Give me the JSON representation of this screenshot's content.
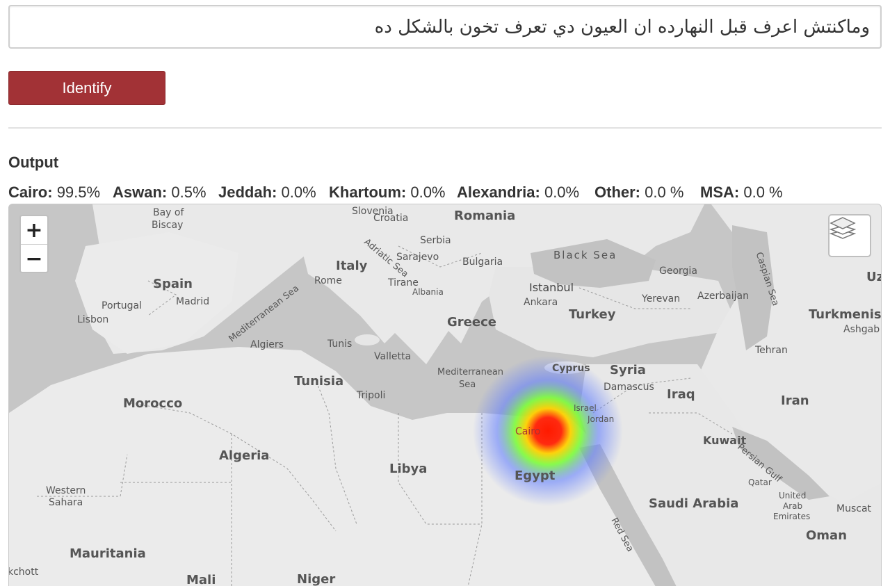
{
  "input": {
    "value": "وماكنتش اعرف قبل النهارده ان العيون دي تعرف تخون بالشكل ده"
  },
  "identify_button": {
    "label": "Identify"
  },
  "output": {
    "heading": "Output",
    "scores": [
      {
        "label": "Cairo:",
        "value": "99.5%"
      },
      {
        "label": "Aswan:",
        "value": "0.5%"
      },
      {
        "label": "Jeddah:",
        "value": "0.0%"
      },
      {
        "label": "Khartoum:",
        "value": "0.0%"
      },
      {
        "label": "Alexandria:",
        "value": "0.0%"
      },
      {
        "label": "Other:",
        "value": "0.0 %"
      },
      {
        "label": "MSA:",
        "value": "0.0 %"
      }
    ]
  },
  "map": {
    "zoom_in": "+",
    "zoom_out": "−",
    "layers_icon": "layers-icon",
    "heat_colors": [
      "#ff0000",
      "#7cfc00",
      "#5a78ff"
    ],
    "labels": {
      "bay_of": "Bay of",
      "biscay": "Biscay",
      "slovenia": "Slovenia",
      "croatia": "Croatia",
      "romania": "Romania",
      "serbia": "Serbia",
      "italy": "Italy",
      "sarajevo": "Sarajevo",
      "bulgaria": "Bulgaria",
      "black_sea": "Black Sea",
      "georgia": "Georgia",
      "caspian_sea": "Caspian Sea",
      "uzb": "Uzb",
      "adriatic_sea": "Adriatic Sea",
      "spain": "Spain",
      "madrid": "Madrid",
      "portugal": "Portugal",
      "lisbon": "Lisbon",
      "rome": "Rome",
      "tirane": "Tirane",
      "albania": "Albania",
      "istanbul": "Istanbul",
      "ankara": "Ankara",
      "yerevan": "Yerevan",
      "azerbaijan": "Azerbaijan",
      "turkmenista": "Turkmenista",
      "ashgab": "Ashgab",
      "turkey": "Turkey",
      "greece": "Greece",
      "mediterranean_sea_w": "Mediterranean Sea",
      "algiers": "Algiers",
      "tunis": "Tunis",
      "valletta": "Valletta",
      "tehran": "Tehran",
      "tunisia": "Tunisia",
      "mediterranean": "Mediterranean",
      "sea": "Sea",
      "cyprus": "Cyprus",
      "syria": "Syria",
      "damascus": "Damascus",
      "iraq": "Iraq",
      "iran": "Iran",
      "tripoli": "Tripoli",
      "morocco": "Morocco",
      "israel": "Israel",
      "jordan": "Jordan",
      "kuwait": "Kuwait",
      "cairo": "Cairo",
      "persian_gulf": "Persian Gulf",
      "algeria": "Algeria",
      "libya": "Libya",
      "egypt": "Egypt",
      "western": "Western",
      "sahara": "Sahara",
      "qatar": "Qatar",
      "saudi_arabia": "Saudi Arabia",
      "united": "United",
      "arab": "Arab",
      "emirates": "Emirates",
      "muscat": "Muscat",
      "red_sea": "Red Sea",
      "oman": "Oman",
      "mauritania": "Mauritania",
      "kchott": "kchott",
      "mali": "Mali",
      "niger": "Niger"
    }
  }
}
